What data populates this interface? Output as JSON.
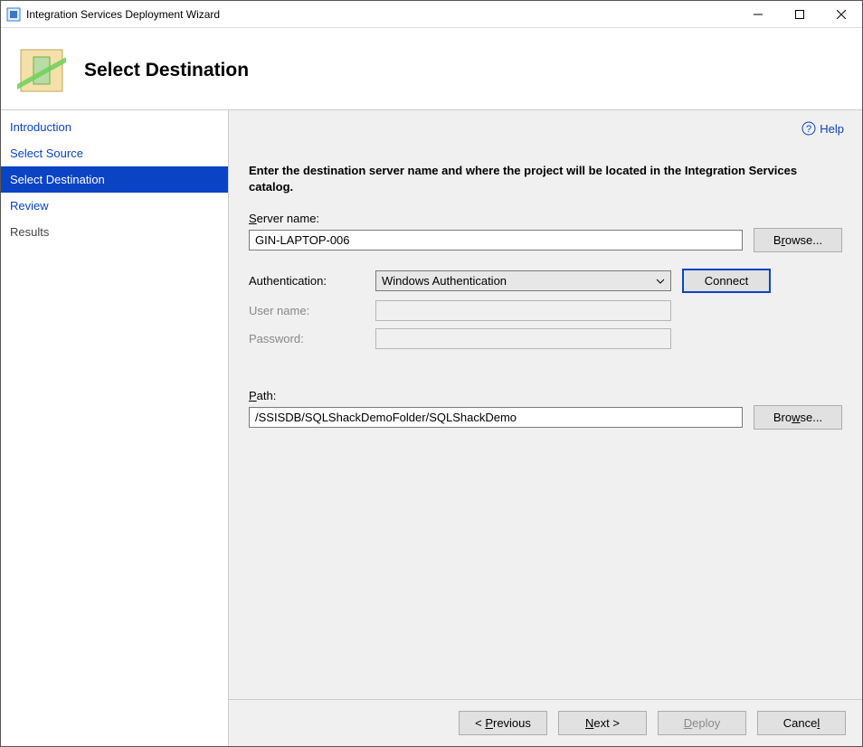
{
  "window": {
    "title": "Integration Services Deployment Wizard"
  },
  "page": {
    "heading": "Select Destination"
  },
  "sidebar": {
    "items": [
      {
        "label": "Introduction",
        "state": "done"
      },
      {
        "label": "Select Source",
        "state": "done"
      },
      {
        "label": "Select Destination",
        "state": "current"
      },
      {
        "label": "Review",
        "state": "done"
      },
      {
        "label": "Results",
        "state": "pending"
      }
    ]
  },
  "helpLabel": "Help",
  "instruction": "Enter the destination server name and where the project will be located in the Integration Services catalog.",
  "labels": {
    "serverName": "Server name:",
    "authentication": "Authentication:",
    "userName": "User name:",
    "password": "Password:",
    "path": "Path:"
  },
  "fields": {
    "serverName": "GIN-LAPTOP-006",
    "authentication": "Windows Authentication",
    "userName": "",
    "password": "",
    "path": "/SSISDB/SQLShackDemoFolder/SQLShackDemo"
  },
  "buttons": {
    "browseServer": "Browse...",
    "connect": "Connect",
    "browsePath": "Browse...",
    "previous": "< Previous",
    "next": "Next >",
    "deploy": "Deploy",
    "cancel": "Cancel"
  }
}
